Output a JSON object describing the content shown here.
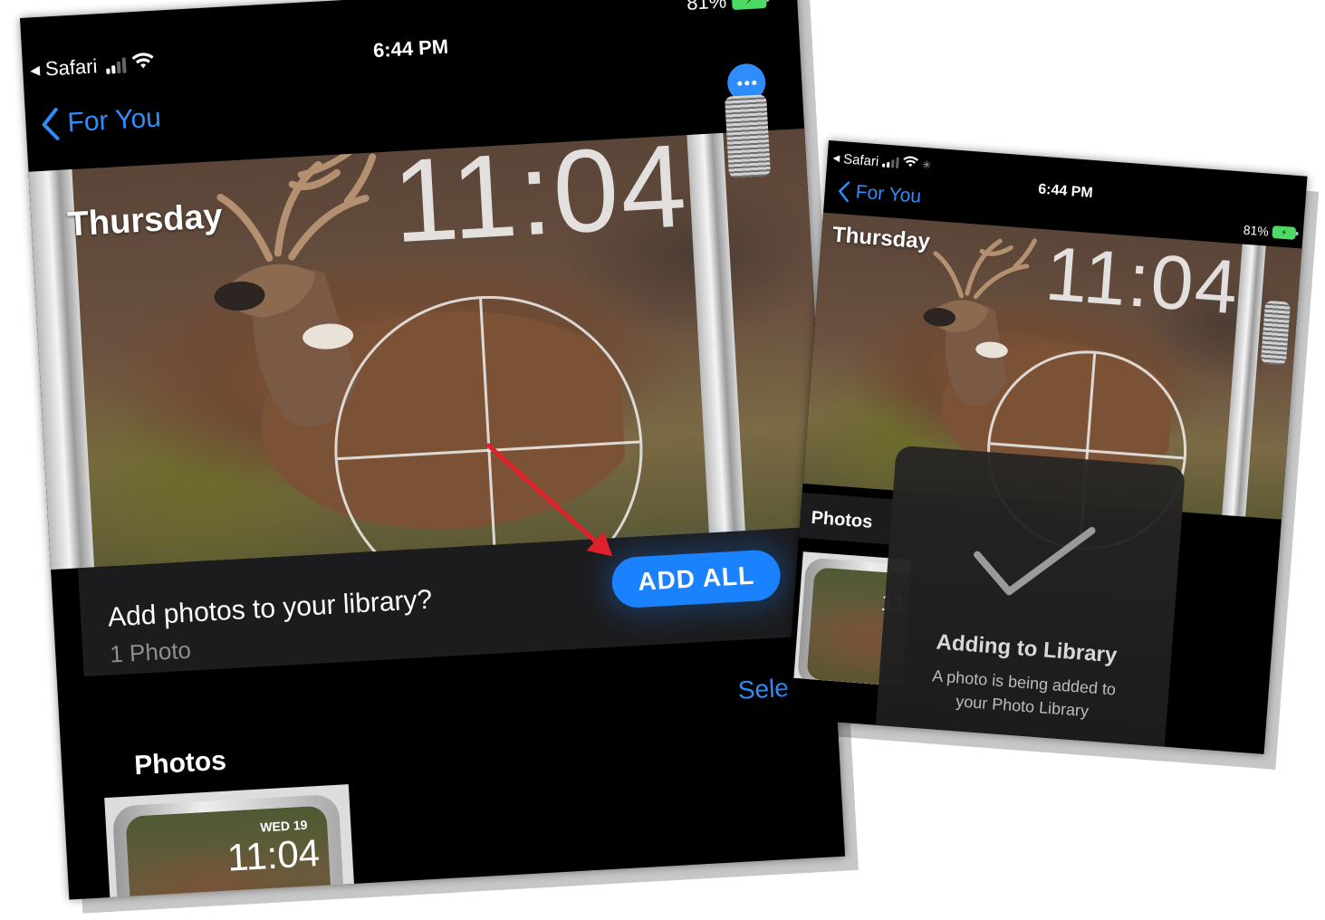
{
  "left_screen": {
    "status": {
      "back_app": "Safari",
      "time": "6:44 PM",
      "battery": "81%"
    },
    "nav": {
      "back_label": "For You"
    },
    "watch_face": {
      "day": "Thursday",
      "time": "11:04"
    },
    "banner": {
      "question": "Add photos to your library?",
      "count": "1 Photo",
      "button": "ADD ALL"
    },
    "section": {
      "title": "Photos",
      "select": "Select"
    },
    "thumbnail": {
      "date": "WED 19",
      "time": "11:04"
    }
  },
  "right_screen": {
    "status": {
      "back_app": "Safari",
      "time": "6:44 PM",
      "battery": "81%"
    },
    "nav": {
      "back_label": "For You"
    },
    "watch_face": {
      "day": "Thursday",
      "time": "11:04"
    },
    "section": {
      "title": "Photos"
    },
    "thumbnail": {
      "time": "11"
    },
    "hud": {
      "title": "Adding to Library",
      "message_line1": "A photo is being added to",
      "message_line2": "your Photo Library"
    }
  },
  "colors": {
    "accent": "#2f8dfb",
    "button": "#1a82ff",
    "battery": "#4cd964",
    "arrow": "#e0202a"
  }
}
